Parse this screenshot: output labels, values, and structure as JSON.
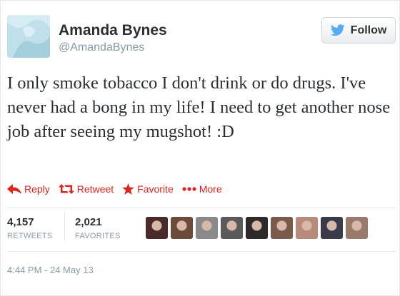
{
  "user": {
    "display_name": "Amanda Bynes",
    "handle": "@AmandaBynes"
  },
  "follow_button": {
    "label": "Follow"
  },
  "tweet": {
    "text": "I only smoke tobacco I don't drink or do drugs. I've never had a bong in my life! I need to get another nose job after seeing my mugshot! :D"
  },
  "actions": {
    "reply": "Reply",
    "retweet": "Retweet",
    "favorite": "Favorite",
    "more": "More"
  },
  "stats": {
    "retweets_count": "4,157",
    "retweets_label": "RETWEETS",
    "favorites_count": "2,021",
    "favorites_label": "FAVORITES"
  },
  "favoriter_avatars": [
    {
      "color": "#4a2a2a"
    },
    {
      "color": "#6b4b3a"
    },
    {
      "color": "#8a8a8a"
    },
    {
      "color": "#5a5a5a"
    },
    {
      "color": "#2f2a2a"
    },
    {
      "color": "#7a5a4a"
    },
    {
      "color": "#b88a7a"
    },
    {
      "color": "#3a3a4a"
    },
    {
      "color": "#9a7a6a"
    }
  ],
  "timestamp": "4:44 PM - 24 May 13",
  "colors": {
    "action_red": "#e0231b",
    "twitter_blue": "#55acee",
    "muted_text": "#8899a6"
  },
  "icons": {
    "follow": "twitter-bird-icon",
    "reply": "reply-arrow-icon",
    "retweet": "retweet-icon",
    "favorite": "star-icon",
    "more": "more-dots-icon"
  }
}
